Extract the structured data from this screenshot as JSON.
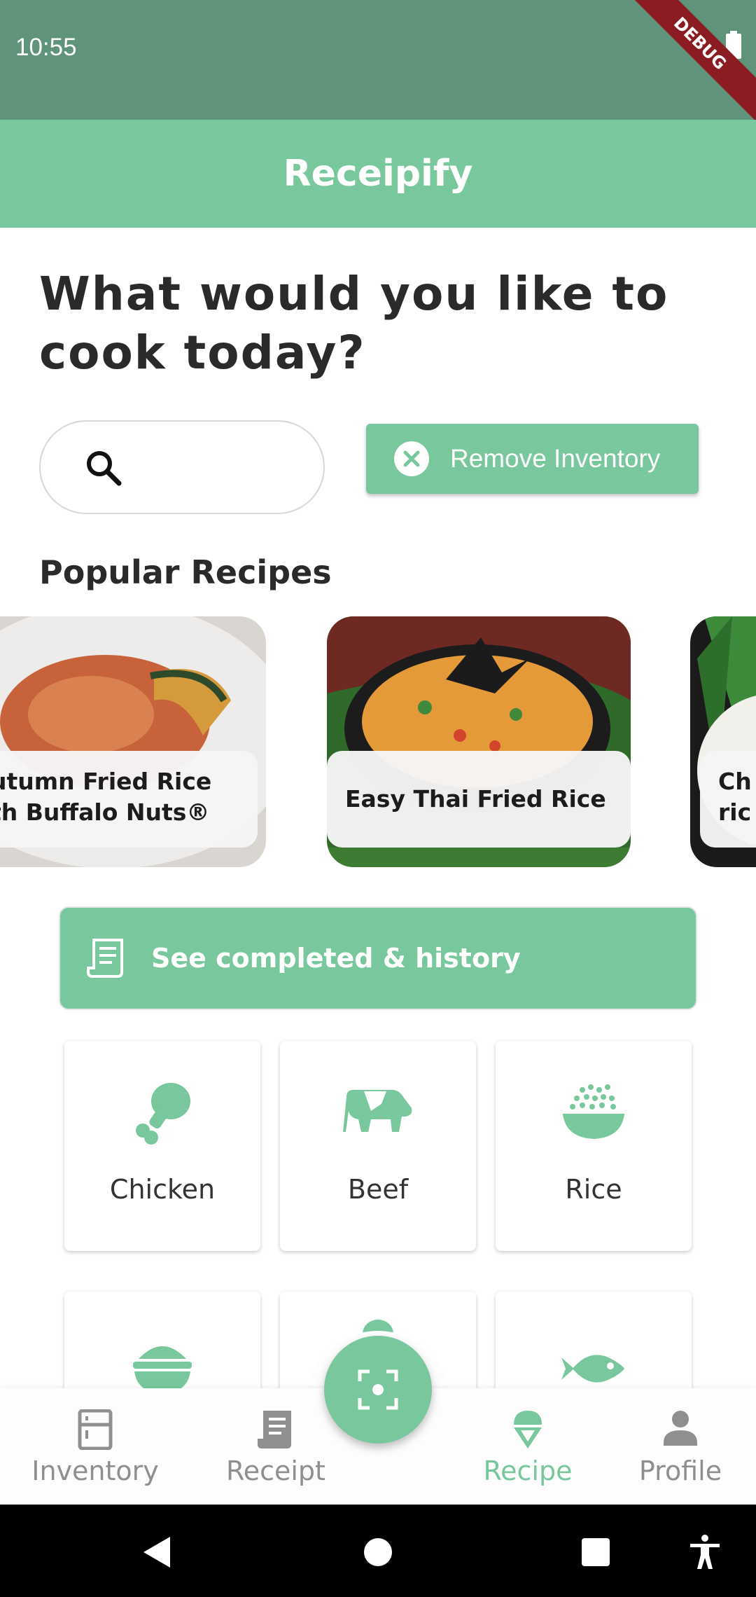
{
  "status_bar": {
    "time": "10:55",
    "debug_label": "DEBUG"
  },
  "app_bar": {
    "title": "Receipify"
  },
  "heading": "What would you like to cook today?",
  "search": {
    "placeholder": ""
  },
  "remove_inventory_label": "Remove Inventory",
  "popular_heading": "Popular Recipes",
  "recipes": [
    {
      "title": "utumn Fried Rice\nth Buffalo Nuts®"
    },
    {
      "title": "Easy Thai Fried Rice"
    },
    {
      "title": "Ch\nric"
    }
  ],
  "history_label": "See completed & history",
  "categories": [
    {
      "label": "Chicken",
      "icon": "drumstick-icon"
    },
    {
      "label": "Beef",
      "icon": "cow-icon"
    },
    {
      "label": "Rice",
      "icon": "rice-bowl-icon"
    },
    {
      "label": "",
      "icon": "bowl-icon"
    },
    {
      "label": "",
      "icon": "egg-icon"
    },
    {
      "label": "",
      "icon": "fish-icon"
    }
  ],
  "bottom_nav": [
    {
      "label": "Inventory",
      "icon": "fridge-icon",
      "active": false
    },
    {
      "label": "Receipt",
      "icon": "receipt-icon",
      "active": false
    },
    {
      "label": "Recipe",
      "icon": "ice-cream-icon",
      "active": true
    },
    {
      "label": "Profile",
      "icon": "person-icon",
      "active": false
    }
  ],
  "colors": {
    "accent": "#78c79d",
    "status_bar": "#5f937a",
    "inactive": "#8f8f8f"
  }
}
